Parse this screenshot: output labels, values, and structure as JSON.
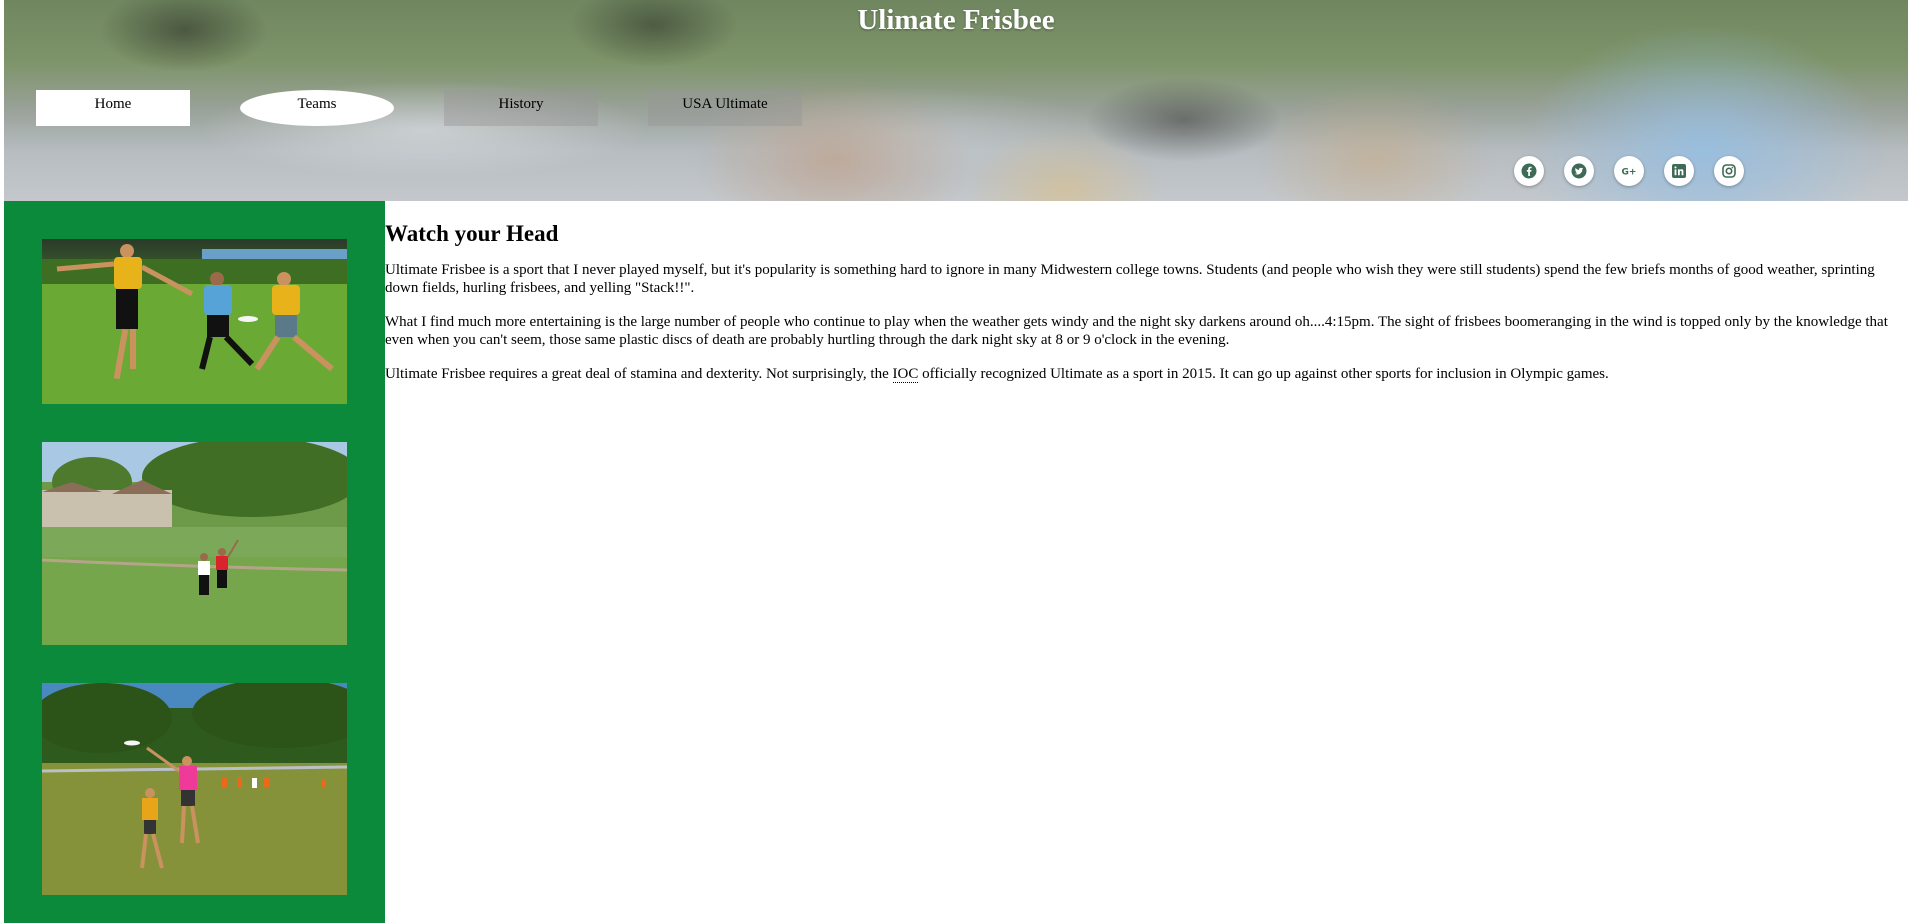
{
  "site": {
    "title": "Ulimate Frisbee"
  },
  "nav": {
    "home": "Home",
    "teams": "Teams",
    "history": "History",
    "usa_ultimate": "USA Ultimate"
  },
  "social": [
    {
      "icon": "facebook-icon"
    },
    {
      "icon": "twitter-icon"
    },
    {
      "icon": "google-plus-icon"
    },
    {
      "icon": "linkedin-icon"
    },
    {
      "icon": "instagram-icon"
    }
  ],
  "colors": {
    "sidebar_green": "#0a8a3a",
    "social_icon": "#3d6b55"
  },
  "article": {
    "heading": "Watch your Head",
    "p1": "Ultimate Frisbee is a sport that I never played myself, but it's popularity is something hard to ignore in many Midwestern college towns. Students (and people who wish they were still students) spend the few briefs months of good weather, sprinting down fields, hurling frisbees, and yelling \"Stack!!\".",
    "p2": "What I find much more entertaining is the large number of people who continue to play when the weather gets windy and the night sky darkens around oh....4:15pm. The sight of frisbees boomeranging in the wind is topped only by the knowledge that even when you can't seem, those same plastic discs of death are probably hurtling through the dark night sky at 8 or 9 o'clock in the evening.",
    "p3_before": "Ultimate Frisbee requires a great deal of stamina and dexterity. Not surprisingly, the ",
    "p3_abbr": "IOC",
    "p3_after": " officially recognized Ultimate as a sport in 2015. It can go up against other sports for inclusion in Olympic games."
  }
}
